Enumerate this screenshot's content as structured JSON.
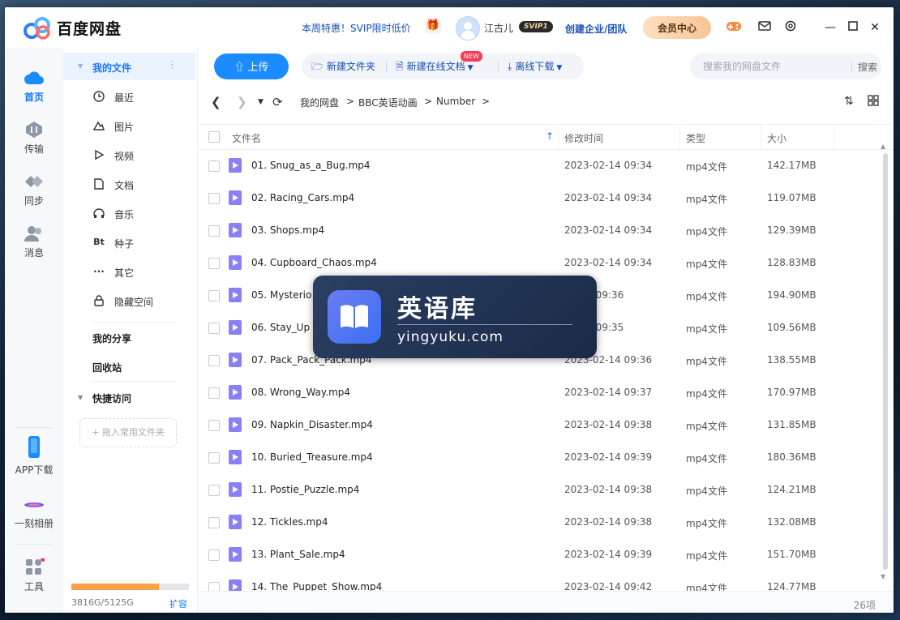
{
  "app": {
    "title": "百度网盘"
  },
  "topbar": {
    "promo": "本周特惠！SVIP限时低价",
    "username": "江古儿",
    "vip_badge": "SVIP1",
    "enterprise": "创建企业/团队",
    "member_center": "会员中心",
    "icons": [
      "gift-icon",
      "game-icon",
      "mail-icon",
      "settings-icon",
      "minimize-icon",
      "maximize-icon",
      "close-icon"
    ]
  },
  "leftnav": {
    "items": [
      {
        "label": "首页",
        "icon": "cloud-icon",
        "active": true
      },
      {
        "label": "传输",
        "icon": "transfer-icon"
      },
      {
        "label": "同步",
        "icon": "sync-icon"
      },
      {
        "label": "消息",
        "icon": "message-icon"
      }
    ],
    "bottom": [
      {
        "label": "APP下载",
        "icon": "phone-icon"
      },
      {
        "label": "一刻相册",
        "icon": "album-icon"
      },
      {
        "label": "工具",
        "icon": "tools-icon"
      }
    ]
  },
  "sidebar": {
    "my_files": "我的文件",
    "items": [
      {
        "label": "最近",
        "icon": "clock-icon"
      },
      {
        "label": "图片",
        "icon": "image-icon"
      },
      {
        "label": "视频",
        "icon": "video-icon"
      },
      {
        "label": "文档",
        "icon": "document-icon"
      },
      {
        "label": "音乐",
        "icon": "music-icon"
      },
      {
        "label": "种子",
        "icon": "bt-icon"
      },
      {
        "label": "其它",
        "icon": "more-icon"
      },
      {
        "label": "隐藏空间",
        "icon": "lock-icon"
      }
    ],
    "my_share": "我的分享",
    "recycle": "回收站",
    "quick_access": "快捷访问",
    "drag_hint": "+ 拖入常用文件夹",
    "storage_text": "3816G/5125G",
    "storage_used_fraction": 0.745,
    "expand": "扩容"
  },
  "toolbar": {
    "upload": "上传",
    "new_folder": "新建文件夹",
    "new_doc": "新建在线文档",
    "new_badge": "NEW",
    "offline": "离线下载",
    "search_placeholder": "搜索我的网盘文件",
    "search_button": "搜索"
  },
  "breadcrumb": [
    "我的网盘",
    "BBC英语动画",
    "Number"
  ],
  "table": {
    "headers": {
      "name": "文件名",
      "time": "修改时间",
      "type": "类型",
      "size": "大小"
    },
    "rows": [
      {
        "name": "01. Snug_as_a_Bug.mp4",
        "time": "2023-02-14 09:34",
        "type": "mp4文件",
        "size": "142.17MB"
      },
      {
        "name": "02. Racing_Cars.mp4",
        "time": "2023-02-14 09:34",
        "type": "mp4文件",
        "size": "119.07MB"
      },
      {
        "name": "03. Shops.mp4",
        "time": "2023-02-14 09:34",
        "type": "mp4文件",
        "size": "129.39MB"
      },
      {
        "name": "04. Cupboard_Chaos.mp4",
        "time": "2023-02-14 09:34",
        "type": "mp4文件",
        "size": "128.83MB"
      },
      {
        "name": "05. Mysterio",
        "time": "02-14 09:36",
        "type": "mp4文件",
        "size": "194.90MB"
      },
      {
        "name": "06. Stay_Up",
        "time": "02-14 09:35",
        "type": "mp4文件",
        "size": "109.56MB"
      },
      {
        "name": "07. Pack_Pack_Pack.mp4",
        "time": "2023-02-14 09:36",
        "type": "mp4文件",
        "size": "138.55MB"
      },
      {
        "name": "08. Wrong_Way.mp4",
        "time": "2023-02-14 09:37",
        "type": "mp4文件",
        "size": "170.97MB"
      },
      {
        "name": "09. Napkin_Disaster.mp4",
        "time": "2023-02-14 09:38",
        "type": "mp4文件",
        "size": "131.85MB"
      },
      {
        "name": "10. Buried_Treasure.mp4",
        "time": "2023-02-14 09:39",
        "type": "mp4文件",
        "size": "180.36MB"
      },
      {
        "name": "11. Postie_Puzzle.mp4",
        "time": "2023-02-14 09:38",
        "type": "mp4文件",
        "size": "124.21MB"
      },
      {
        "name": "12. Tickles.mp4",
        "time": "2023-02-14 09:38",
        "type": "mp4文件",
        "size": "132.08MB"
      },
      {
        "name": "13. Plant_Sale.mp4",
        "time": "2023-02-14 09:39",
        "type": "mp4文件",
        "size": "151.70MB"
      },
      {
        "name": "14. The_Puppet_Show.mp4",
        "time": "2023-02-14 09:42",
        "type": "mp4文件",
        "size": "124.77MB"
      }
    ],
    "count": "26项"
  },
  "watermark": {
    "title": "英语库",
    "url": "yingyuku.com"
  },
  "colors": {
    "accent": "#1677ff",
    "upload": "#1a8cff",
    "file_icon": "#8b7ff5",
    "storage": "#f8a149"
  }
}
